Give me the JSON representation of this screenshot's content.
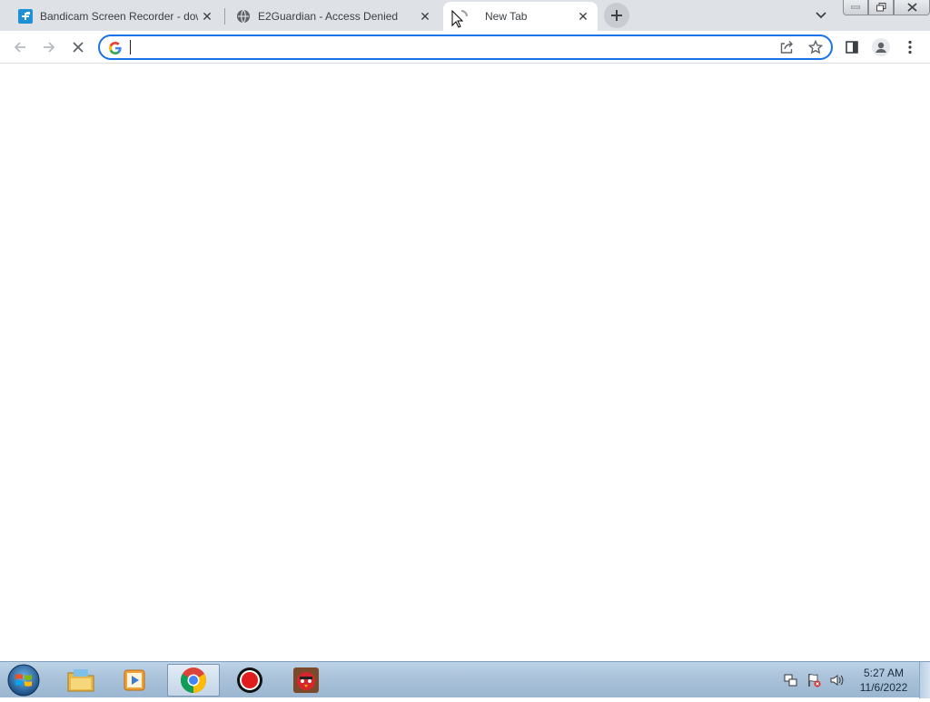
{
  "browser": {
    "tabs": [
      {
        "title": "Bandicam Screen Recorder - download",
        "favicon": "bandicam-icon",
        "active": false
      },
      {
        "title": "E2Guardian - Access Denied",
        "favicon": "globe-icon",
        "active": false
      },
      {
        "title": "New Tab",
        "favicon": "loading-icon",
        "active": true
      }
    ],
    "omnibox": {
      "value": "",
      "placeholder": ""
    },
    "colors": {
      "accent": "#1a73e8",
      "tabstrip": "#dee1e6"
    }
  },
  "taskbar": {
    "apps": [
      "file-explorer-icon",
      "media-player-icon",
      "chrome-icon",
      "bandicam-record-icon",
      "angry-birds-icon"
    ],
    "clock": {
      "time": "5:27 AM",
      "date": "11/6/2022"
    }
  }
}
